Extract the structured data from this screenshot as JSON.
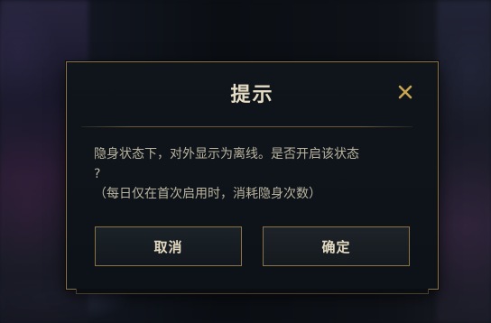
{
  "dialog": {
    "title": "提示",
    "close_icon": "close-icon",
    "message_line1": "隐身状态下，对外显示为离线。是否开启该状态",
    "message_line2": "?",
    "message_line3": "（每日仅在首次启用时，消耗隐身次数）",
    "cancel_label": "取消",
    "confirm_label": "确定"
  },
  "watermark": "",
  "colors": {
    "border_gold": "#8a7344",
    "title_text": "#e6dcc4",
    "body_text": "#b9b39f",
    "close_icon": "#c9a552",
    "dialog_bg": "#0f151b"
  }
}
